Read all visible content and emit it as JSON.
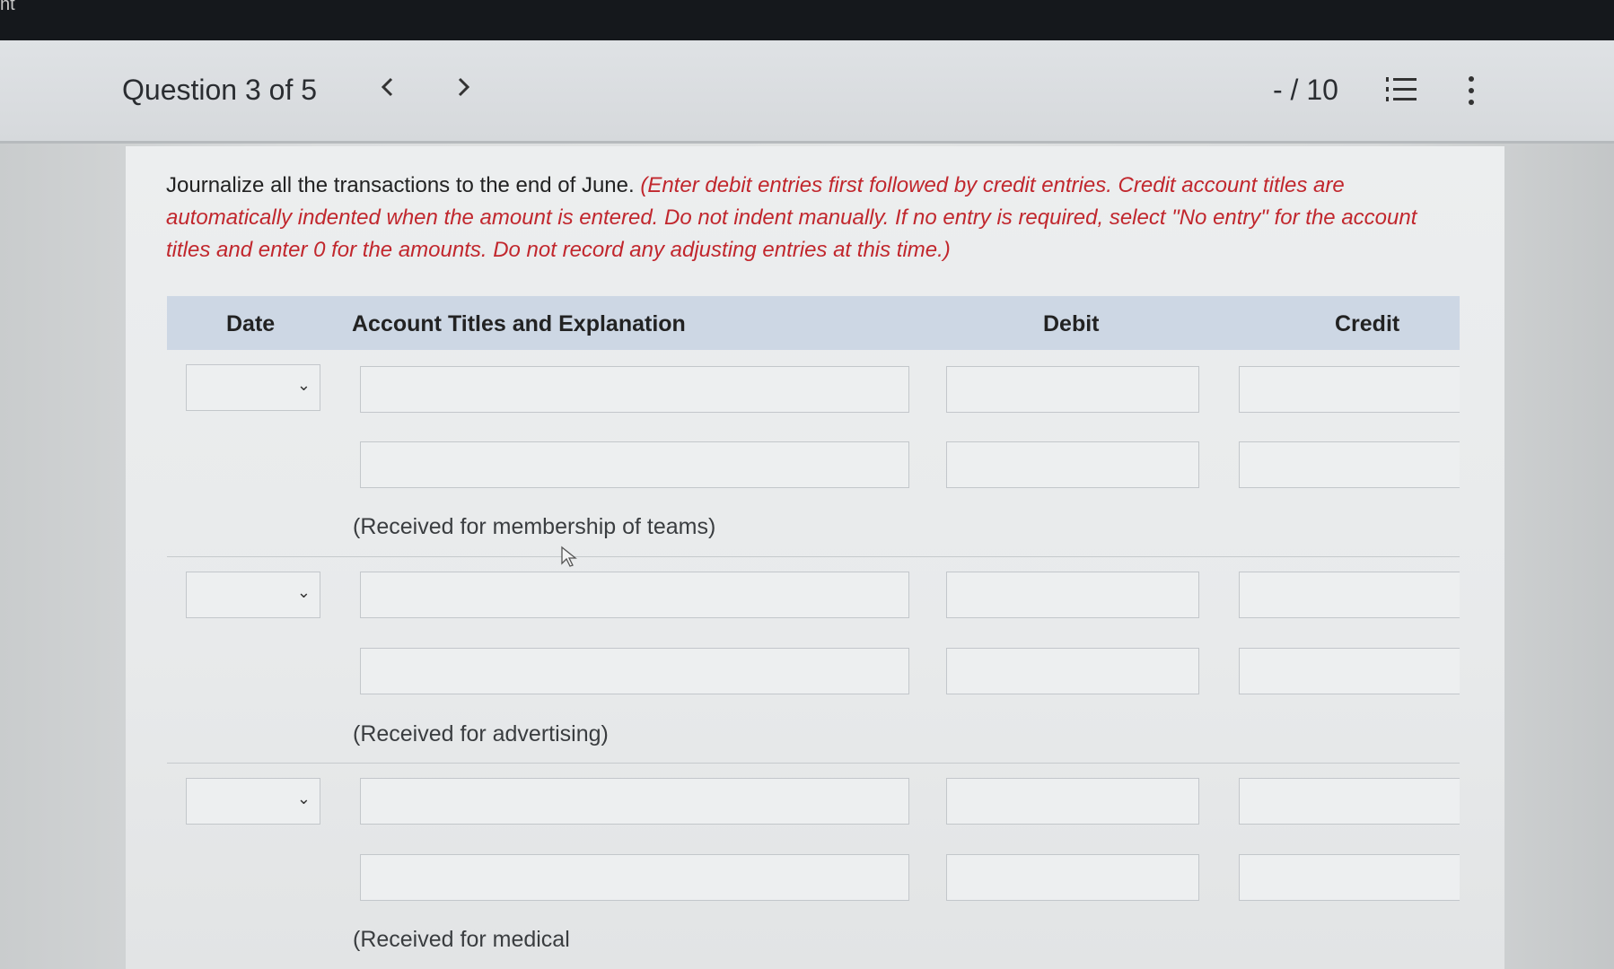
{
  "topbar": {
    "corner_text": "nt"
  },
  "header": {
    "question_label": "Question 3 of 5",
    "prev_glyph": "‹",
    "next_glyph": "›",
    "score": "- / 10"
  },
  "instructions": {
    "plain": "Journalize all the transactions to the end of June. ",
    "emphasis": "(Enter debit entries first followed by credit entries. Credit account titles are automatically indented when the amount is entered. Do not indent manually. If no entry is required, select \"No entry\" for the account titles and enter 0 for the amounts. Do not record any adjusting entries at this time.)"
  },
  "table": {
    "columns": {
      "date": "Date",
      "account": "Account Titles and Explanation",
      "debit": "Debit",
      "credit": "Credit"
    },
    "entries": [
      {
        "date": "",
        "lines": [
          {
            "account": "",
            "debit": "",
            "credit": ""
          },
          {
            "account": "",
            "debit": "",
            "credit": ""
          }
        ],
        "explanation": "(Received for membership of teams)"
      },
      {
        "date": "",
        "lines": [
          {
            "account": "",
            "debit": "",
            "credit": ""
          },
          {
            "account": "",
            "debit": "",
            "credit": ""
          }
        ],
        "explanation": "(Received for advertising)"
      },
      {
        "date": "",
        "lines": [
          {
            "account": "",
            "debit": "",
            "credit": ""
          },
          {
            "account": "",
            "debit": "",
            "credit": ""
          }
        ],
        "explanation": "(Received for medical"
      }
    ]
  },
  "colors": {
    "instruction_red": "#c1272d",
    "table_header_bg": "#cdd7e4",
    "topbar_bg": "#15181c"
  }
}
